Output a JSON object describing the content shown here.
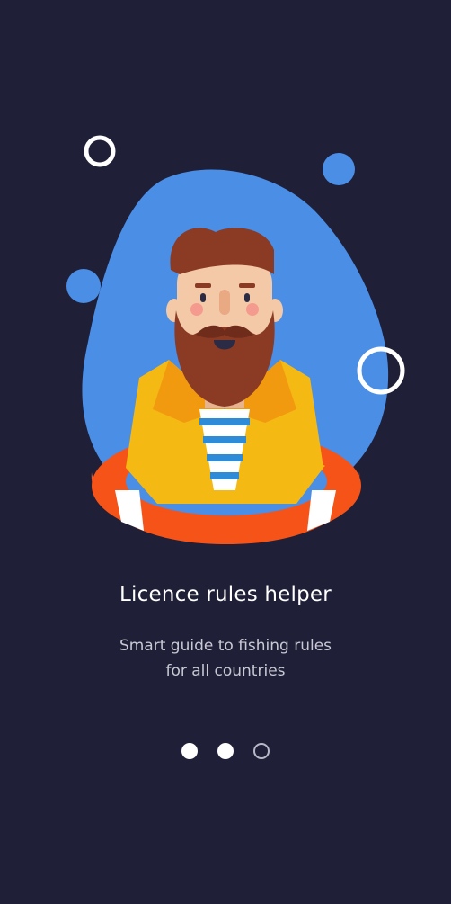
{
  "onboarding": {
    "title": "Licence rules helper",
    "subtitle_line1": "Smart guide to fishing rules",
    "subtitle_line2": "for all countries",
    "pagination": {
      "total": 3,
      "active_states": [
        "filled",
        "filled",
        "outline"
      ]
    }
  },
  "colors": {
    "background": "#1f1f38",
    "blob": "#4a8ee6",
    "beard": "#8b3a24",
    "skin": "#f3c9a8",
    "jacket": "#f5b914",
    "lifebuoy": "#f55318",
    "stripe": "#2d8bd8"
  },
  "icons": {
    "illustration": "fisherman-illustration"
  }
}
